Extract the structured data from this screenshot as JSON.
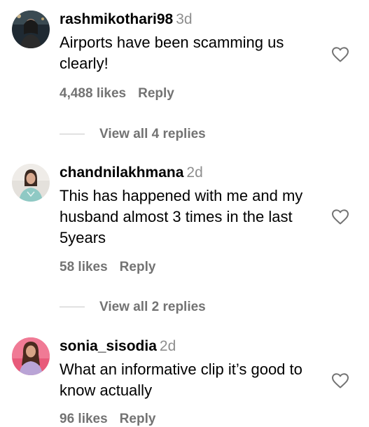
{
  "comments": [
    {
      "username": "rashmikothari98",
      "time": "3d",
      "text": "Airports have been scamming us clearly!",
      "likes": "4,488 likes",
      "reply_label": "Reply",
      "view_replies": "View all 4 replies",
      "avatar_icon": "profile-photo"
    },
    {
      "username": "chandnilakhmana",
      "time": "2d",
      "text": "This has happened with me and my husband almost 3 times in the last 5years",
      "likes": "58 likes",
      "reply_label": "Reply",
      "view_replies": "View all 2 replies",
      "avatar_icon": "profile-photo"
    },
    {
      "username": "sonia_sisodia",
      "time": "2d",
      "text": "What an informative clip it’s good to know actually",
      "likes": "96 likes",
      "reply_label": "Reply",
      "avatar_icon": "profile-photo"
    }
  ],
  "icons": {
    "like": "heart-outline-icon"
  },
  "colors": {
    "text": "#000000",
    "secondary": "#737373",
    "timestamp": "#8e8e8e",
    "divider": "#c7c7c7"
  }
}
